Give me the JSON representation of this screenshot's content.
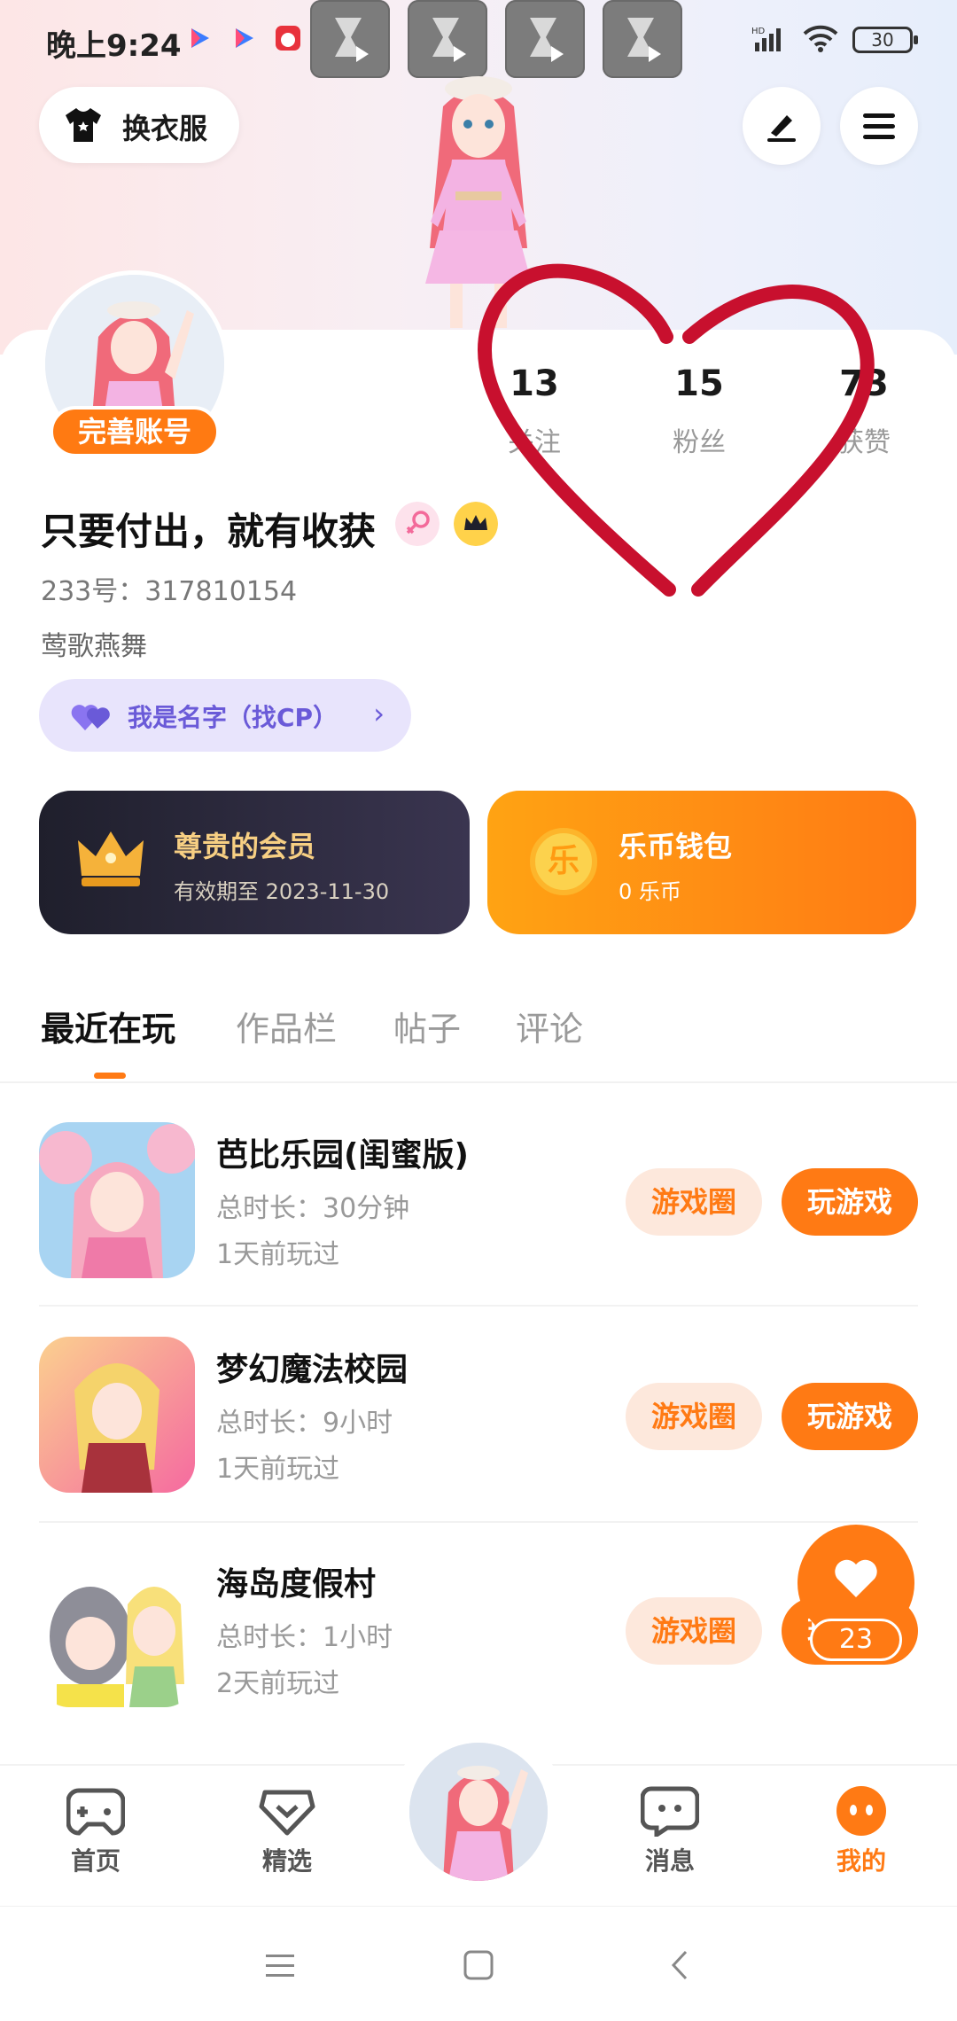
{
  "status": {
    "time": "晚上9:24",
    "signal": "HD",
    "battery": "30"
  },
  "header": {
    "dress_label": "换衣服"
  },
  "profile": {
    "perfect_label": "完善账号",
    "stats": [
      {
        "num": "13",
        "label": "关注"
      },
      {
        "num": "15",
        "label": "粉丝"
      },
      {
        "num": "73",
        "label": "获赞"
      }
    ],
    "nickname": "只要付出，就有收获",
    "uid": "233号：317810154",
    "signature": "莺歌燕舞",
    "cp_label": "我是名字（找CP）",
    "cp_arrow": "›"
  },
  "vip": {
    "title": "尊贵的会员",
    "expiry": "有效期至 2023-11-30"
  },
  "wallet": {
    "title": "乐币钱包",
    "amount": "0 乐币",
    "coin_glyph": "乐"
  },
  "tabs": [
    "最近在玩",
    "作品栏",
    "帖子",
    "评论"
  ],
  "games": [
    {
      "name": "芭比乐园(闺蜜版)",
      "duration": "总时长：30分钟",
      "last": "1天前玩过",
      "circle": "游戏圈",
      "play": "玩游戏"
    },
    {
      "name": "梦幻魔法校园",
      "duration": "总时长：9小时",
      "last": "1天前玩过",
      "circle": "游戏圈",
      "play": "玩游戏"
    },
    {
      "name": "海岛度假村",
      "duration": "总时长：1小时",
      "last": "2天前玩过",
      "circle": "游戏圈",
      "play": "玩游戏"
    }
  ],
  "fab": {
    "count": "23"
  },
  "nav": [
    {
      "label": "首页"
    },
    {
      "label": "精选"
    },
    {
      "label": "消息"
    },
    {
      "label": "我的"
    }
  ],
  "colors": {
    "accent": "#ff7a14",
    "cp": "#6a5ad8",
    "gold": "#f7cf83",
    "annotation_heart": "#c8102e"
  }
}
